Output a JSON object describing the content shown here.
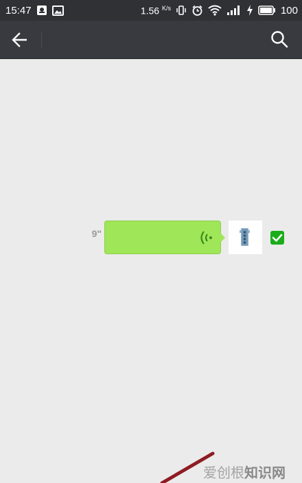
{
  "status_bar": {
    "time": "15:47",
    "net_speed": "1.56",
    "net_speed_unit": "K/s",
    "battery": "100",
    "icons": [
      "notification-icon",
      "image-icon",
      "vibrate-icon",
      "alarm-icon",
      "wifi-icon",
      "signal-icon",
      "charging-icon",
      "battery-icon"
    ]
  },
  "header": {
    "back_icon": "back-arrow-icon",
    "search_icon": "search-icon"
  },
  "chat": {
    "messages": [
      {
        "type": "voice",
        "duration": "9\"",
        "bubble_color": "#9fe658",
        "selected": true
      }
    ],
    "check_color": "#1aad19"
  },
  "watermark": {
    "text_main": "爱创根",
    "text_tail": "知识网"
  }
}
